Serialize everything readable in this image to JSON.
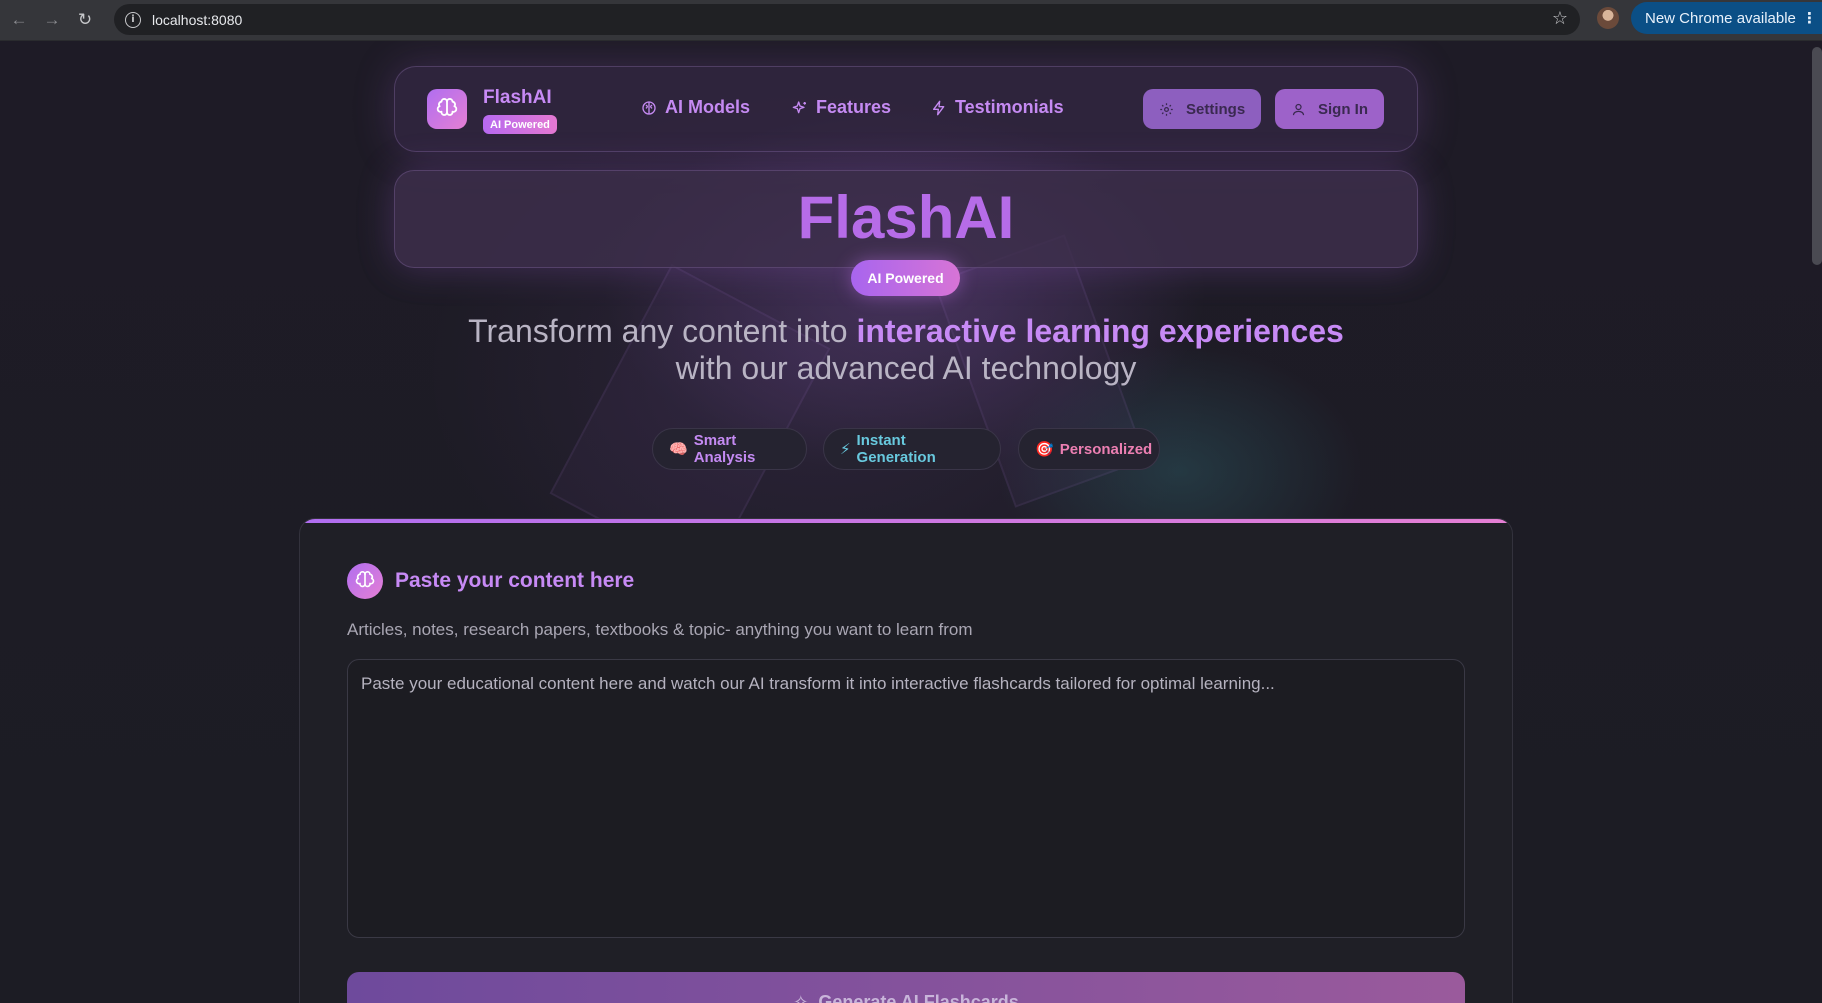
{
  "browser": {
    "url": "localhost:8080",
    "update_label": "New Chrome available"
  },
  "header": {
    "brand": "FlashAI",
    "brand_badge": "AI Powered",
    "nav": [
      {
        "label": "AI Models",
        "icon": "brain-icon"
      },
      {
        "label": "Features",
        "icon": "sparkles-icon"
      },
      {
        "label": "Testimonials",
        "icon": "zap-icon"
      }
    ],
    "settings_label": "Settings",
    "signin_label": "Sign In"
  },
  "hero": {
    "title": "FlashAI",
    "badge": "AI Powered",
    "tagline_pre": "Transform any content into ",
    "tagline_highlight": "interactive learning experiences",
    "tagline_post": "with our advanced AI technology",
    "chips": [
      {
        "emoji": "🧠",
        "label": "Smart Analysis"
      },
      {
        "emoji": "⚡",
        "label": "Instant Generation"
      },
      {
        "emoji": "🎯",
        "label": "Personalized"
      }
    ]
  },
  "main": {
    "title": "Paste your content here",
    "subtitle": "Articles, notes, research papers, textbooks & topic- anything you want to learn from",
    "placeholder": "Paste your educational content here and watch our AI transform it into interactive flashcards tailored for optimal learning...",
    "value": "",
    "generate_label": "Generate AI Flashcards"
  },
  "colors": {
    "accent": "#c78af5",
    "accent_gradient_start": "#b06ef0",
    "accent_gradient_end": "#e57fd4",
    "chip_cyan": "#68c9de",
    "chip_pink": "#ec7fb2",
    "update_blue": "#0b4f86"
  }
}
